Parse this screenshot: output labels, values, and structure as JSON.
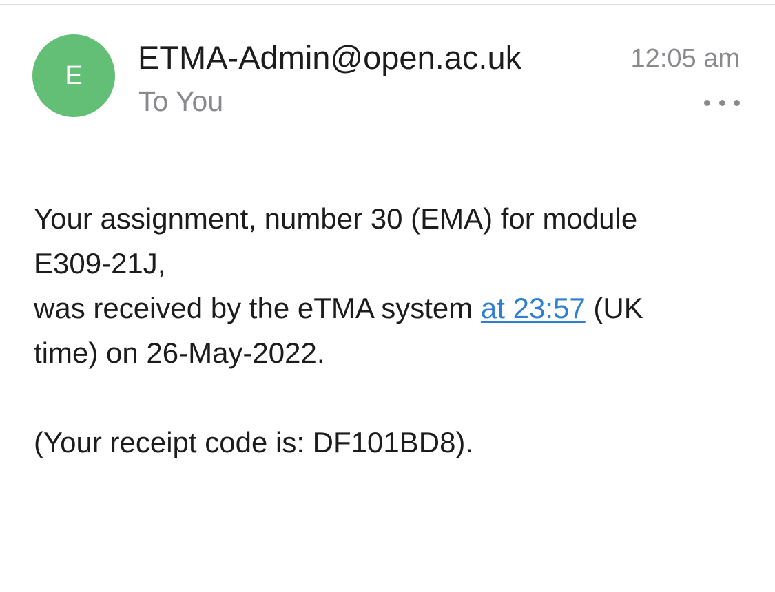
{
  "header": {
    "avatar_initial": "E",
    "avatar_color": "#62bf75",
    "sender": "ETMA-Admin@open.ac.uk",
    "recipient": "To You",
    "time": "12:05 am",
    "more_icon": "more-horizontal-icon"
  },
  "message": {
    "line1": "Your assignment, number 30 (EMA) for module",
    "line2": "E309-21J,",
    "line3_before_link": "was received by the eTMA system ",
    "line3_link": "at 23:57",
    "line3_after_link": " (UK",
    "line4": "time) on 26-May-2022.",
    "receipt": "(Your receipt code is: DF101BD8).",
    "link_color": "#2f7fd0"
  }
}
